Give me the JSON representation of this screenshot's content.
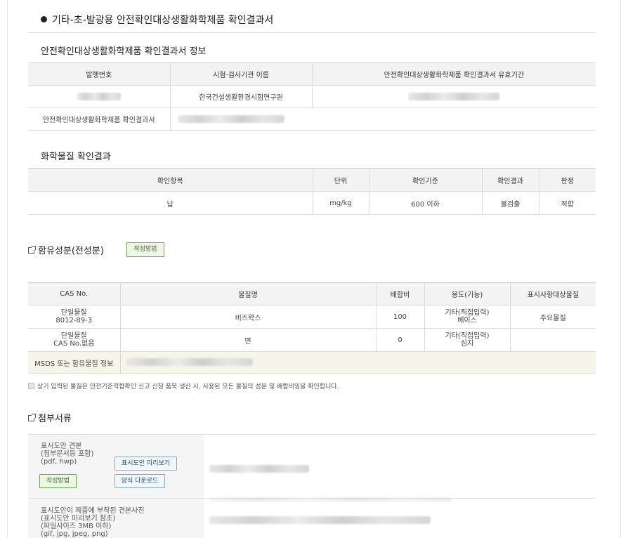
{
  "page_title": "기타-초-발광용 안전확인대상생활화학제품 확인결과서",
  "info": {
    "title": "안전확인대상생활화학제품 확인결과서 정보",
    "headers": [
      "발행번호",
      "시험·검사기관 이름",
      "안전확인대상생활화학제품 확인결과서 유효기간"
    ],
    "agency": "한국건설생활환경시험연구원",
    "file_label": "안전확인대상생활화학제품 확인결과서"
  },
  "chem": {
    "title": "화학물질 확인결과",
    "headers": [
      "확인항목",
      "단위",
      "확인기준",
      "확인결과",
      "판정"
    ],
    "row": [
      "납",
      "mg/kg",
      "600 이하",
      "불검출",
      "적합"
    ]
  },
  "ingredients": {
    "title": "함유성분(전성분)",
    "guide_button": "작성방법",
    "headers": [
      "CAS No.",
      "물질명",
      "배합비",
      "용도(기능)",
      "표시사항대상물질"
    ],
    "rows": [
      {
        "cas1": "단일물질",
        "cas2": "8012-89-3",
        "name": "비즈왁스",
        "ratio": "100",
        "use1": "기타(직접입력)",
        "use2": "베이스",
        "label": "주요물질"
      },
      {
        "cas1": "단일물질",
        "cas2": "CAS No.없음",
        "name": "면",
        "ratio": "0",
        "use1": "기타(직접입력)",
        "use2": "심지",
        "label": ""
      }
    ],
    "msds_label": "MSDS 또는 함유물질 정보",
    "confirm_text": "상기 입력된 물질은 안전기준적합확인 신고 신청 품목 생산 시, 사용된 모든 물질의 성분 및 배합비임을 확인합니다."
  },
  "attachments": {
    "title": "첨부서류",
    "item1": {
      "l1": "표시도안 견본",
      "l2": "(첨부문서등 포함)",
      "l3": "(pdf, hwp)",
      "guide_button": "작성방법",
      "preview_button": "표시도안 미리보기",
      "download_button": "양식 다운로드"
    },
    "item2": {
      "l1": "표시도안이 제품에 부착된 견본사진",
      "l2": "(표시도안 미리보기 참조)",
      "l3": "(파일사이즈 3MB 이하)",
      "l4": "(gif, jpg, jpeg, png)"
    }
  }
}
